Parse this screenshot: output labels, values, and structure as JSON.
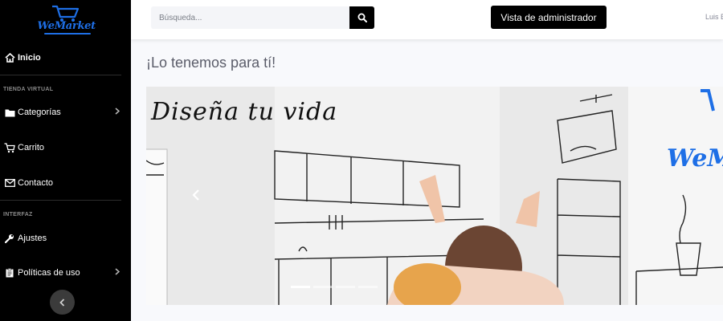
{
  "brand": {
    "name": "WeMarket",
    "color": "#1e6fe6"
  },
  "sidebar": {
    "home": {
      "label": "Inicio",
      "icon": "home-icon"
    },
    "sections": [
      {
        "heading": "TIENDA VIRTUAL",
        "items": [
          {
            "label": "Categorías",
            "icon": "folder-icon",
            "has_chevron": true
          },
          {
            "label": "Carrito",
            "icon": "cart-icon",
            "has_chevron": false
          },
          {
            "label": "Contacto",
            "icon": "envelope-icon",
            "has_chevron": false
          }
        ]
      },
      {
        "heading": "INTERFAZ",
        "items": [
          {
            "label": "Ajustes",
            "icon": "wrench-icon",
            "has_chevron": false
          },
          {
            "label": "Políticas de uso",
            "icon": "clipboard-icon",
            "has_chevron": true
          }
        ]
      }
    ],
    "toggle_icon": "chevron-left-icon"
  },
  "topbar": {
    "search": {
      "placeholder": "Búsqueda...",
      "value": "",
      "icon": "search-icon"
    },
    "admin_button": "Vista de administrador",
    "user_name": "Luis E"
  },
  "main": {
    "title": "¡Lo tenemos para tí!",
    "carousel": {
      "caption": "Diseña tu vida",
      "overlay_brand": "WeMa",
      "indicators": 4,
      "active_indicator": 0
    }
  }
}
